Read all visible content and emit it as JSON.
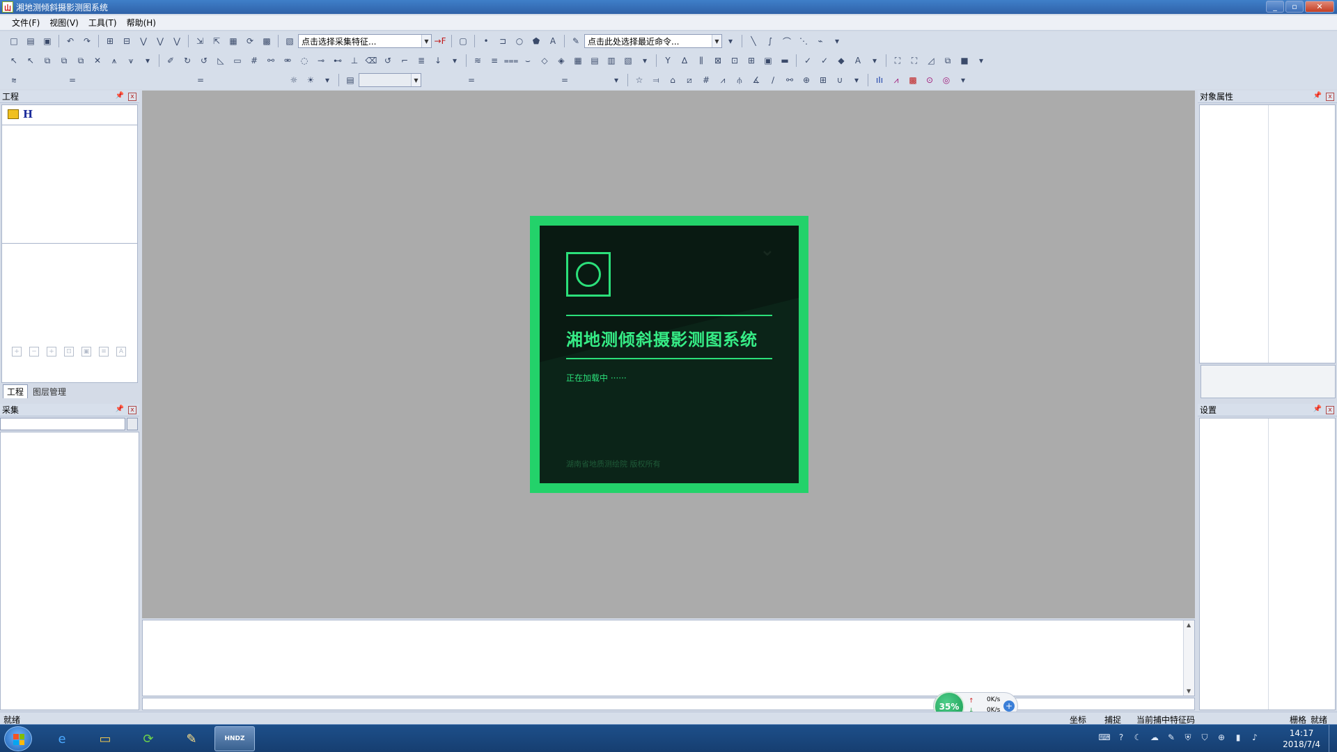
{
  "window": {
    "title": "湘地测倾斜摄影测图系统",
    "app_icon_glyph": "山",
    "minimize": "_",
    "maximize": "▫",
    "close": "✕"
  },
  "menu": {
    "items": [
      "文件(F)",
      "视图(V)",
      "工具(T)",
      "帮助(H)"
    ]
  },
  "toolbar": {
    "feature_combo": "点击选择采集特征...",
    "command_combo": "点击此处选择最近命令...",
    "combo_arrow": "▼"
  },
  "left_panels": {
    "project": {
      "title": "工程",
      "root_label": "H",
      "pin": "📌",
      "close": "x"
    },
    "tabs": [
      "工程",
      "图层管理"
    ],
    "collect": {
      "title": "采集",
      "pin": "📌",
      "close": "x"
    }
  },
  "right_panels": {
    "properties": {
      "title": "对象属性",
      "pin": "📌",
      "close": "x"
    },
    "settings": {
      "title": "设置",
      "pin": "📌",
      "close": "x"
    }
  },
  "splash": {
    "title": "湘地测倾斜摄影测图系统",
    "loading": "正在加载中 ······",
    "copyright": "湖南省地质测绘院  版权所有"
  },
  "network": {
    "percent": "35%",
    "up_arrow": "↑",
    "down_arrow": "↓",
    "up_speed": "0K/s",
    "down_speed": "0K/s",
    "plus": "+"
  },
  "status_bar": {
    "ready_left": "就绪",
    "coord": "坐标",
    "snap": "捕捉",
    "current_snap_code": "当前捕中特征码",
    "grid": "栅格",
    "ready_right": "就绪"
  },
  "taskbar": {
    "clock_time": "14:17",
    "clock_date": "2018/7/4",
    "active_app_label": "HNDZ"
  },
  "colors": {
    "splash_frame": "#23d26a",
    "splash_title": "#36ec86",
    "canvas_bg": "#ababab"
  }
}
